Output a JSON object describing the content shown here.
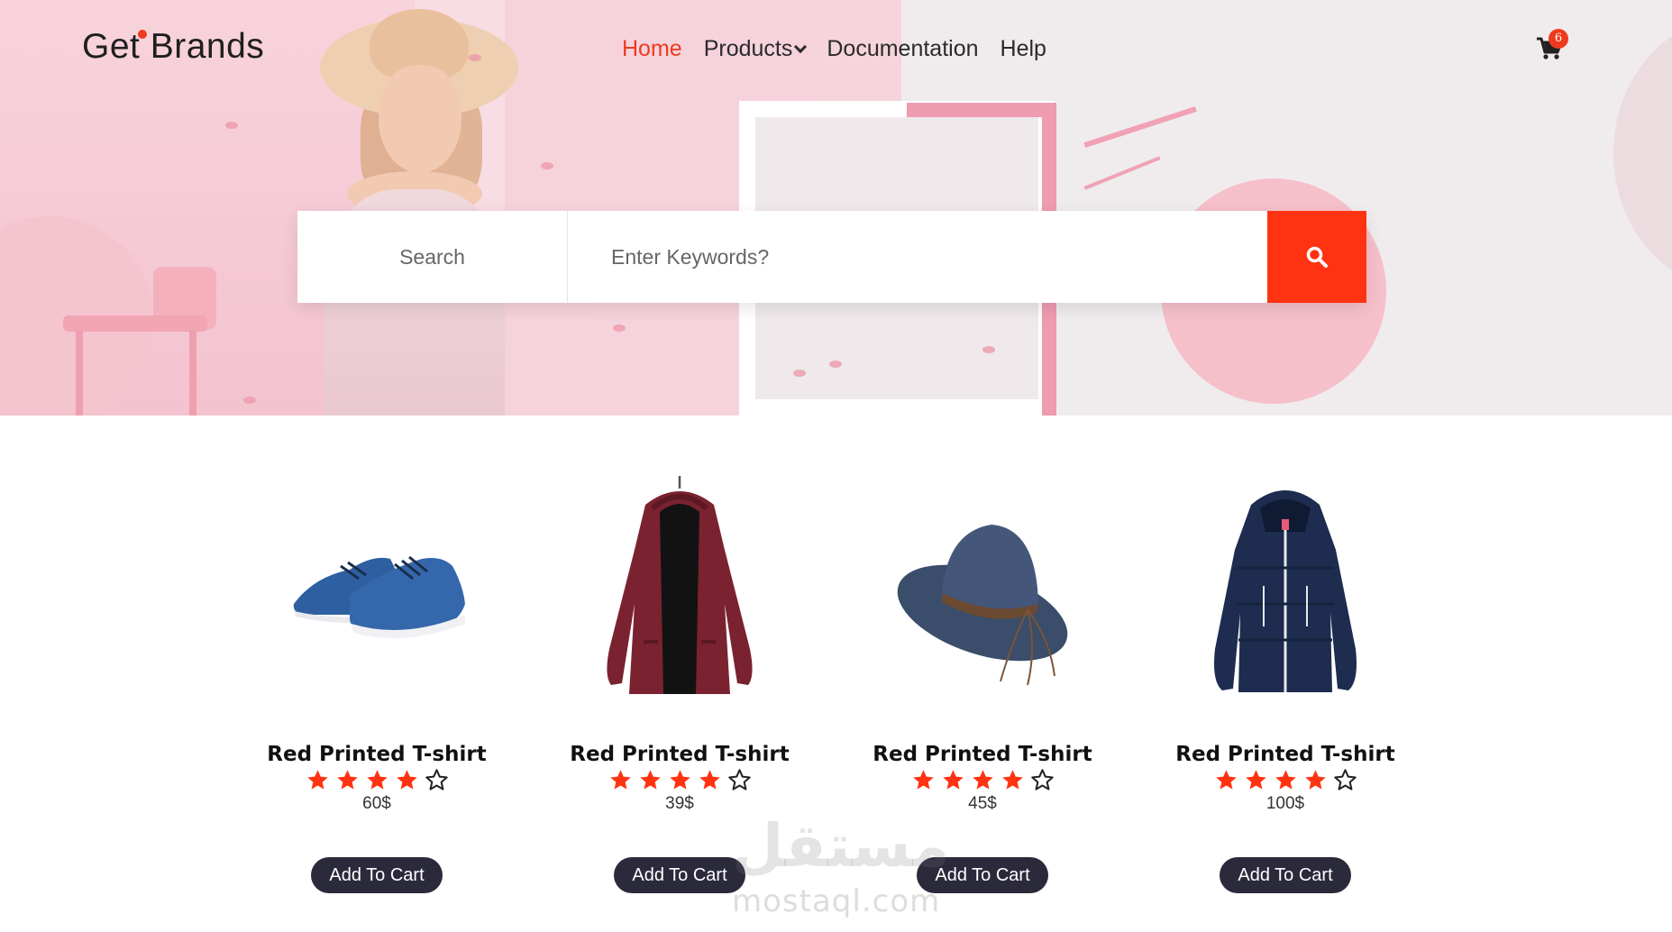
{
  "brand": {
    "name": "Get Brands"
  },
  "nav": {
    "items": [
      {
        "label": "Home",
        "active": true
      },
      {
        "label": "Products",
        "dropdown": true
      },
      {
        "label": "Documentation"
      },
      {
        "label": "Help"
      }
    ]
  },
  "cart": {
    "icon": "cart-icon",
    "count": "6"
  },
  "search": {
    "label": "Search",
    "placeholder": "Enter Keywords?",
    "button_icon": "search-icon"
  },
  "products": [
    {
      "name": "Red Printed T-shirt",
      "rating": 4,
      "rating_max": 5,
      "price": "60$",
      "button": "Add To Cart",
      "image": "blue-sneakers"
    },
    {
      "name": "Red Printed T-shirt",
      "rating": 4,
      "rating_max": 5,
      "price": "39$",
      "button": "Add To Cart",
      "image": "maroon-hooded-coat"
    },
    {
      "name": "Red Printed T-shirt",
      "rating": 4,
      "rating_max": 5,
      "price": "45$",
      "button": "Add To Cart",
      "image": "blue-hat"
    },
    {
      "name": "Red Printed T-shirt",
      "rating": 4,
      "rating_max": 5,
      "price": "100$",
      "button": "Add To Cart",
      "image": "navy-puffer-jacket"
    }
  ],
  "watermark": {
    "arabic": "مستقل",
    "latin": "mostaql.com"
  },
  "colors": {
    "accent": "#ff3312",
    "button_dark": "#2b2a3b",
    "star": "#ff3312"
  }
}
